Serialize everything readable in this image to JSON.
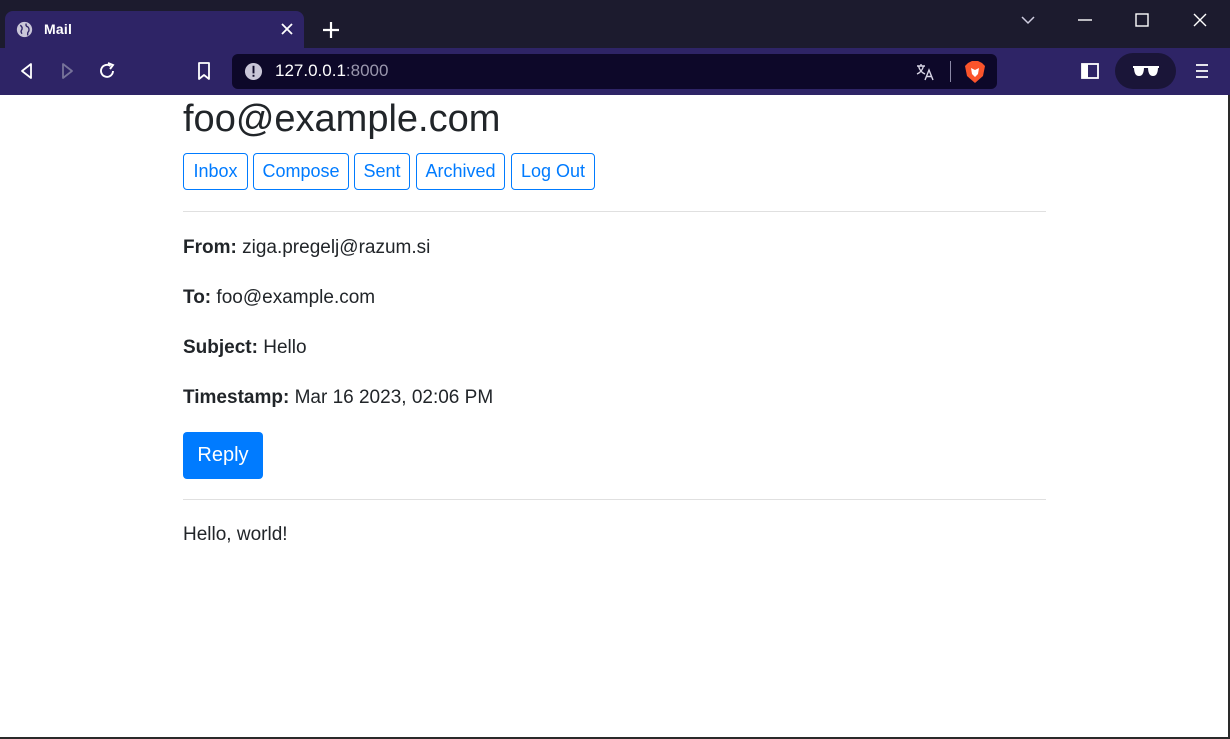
{
  "browser": {
    "tab_title": "Mail",
    "url_host": "127.0.0.1",
    "url_port": ":8000"
  },
  "page": {
    "account": "foo@example.com",
    "nav": [
      "Inbox",
      "Compose",
      "Sent",
      "Archived",
      "Log Out"
    ],
    "email": {
      "from_label": "From:",
      "from_value": "ziga.pregelj@razum.si",
      "to_label": "To:",
      "to_value": "foo@example.com",
      "subject_label": "Subject:",
      "subject_value": "Hello",
      "timestamp_label": "Timestamp:",
      "timestamp_value": "Mar 16 2023, 02:06 PM",
      "reply_label": "Reply",
      "body": "Hello, world!"
    }
  },
  "colors": {
    "primary": "#007bff",
    "tab_strip": "#1c1b2e",
    "toolbar": "#2e2466",
    "urlbar": "#0d0829"
  },
  "icons": [
    "globe-icon",
    "close-icon",
    "plus-icon",
    "chevron-down-icon",
    "minimize-icon",
    "maximize-icon",
    "window-close-icon",
    "back-icon",
    "forward-icon",
    "reload-icon",
    "bookmark-icon",
    "info-warning-icon",
    "translate-icon",
    "brave-shield-icon",
    "sidebar-icon",
    "wallet-glasses-icon",
    "menu-icon"
  ]
}
